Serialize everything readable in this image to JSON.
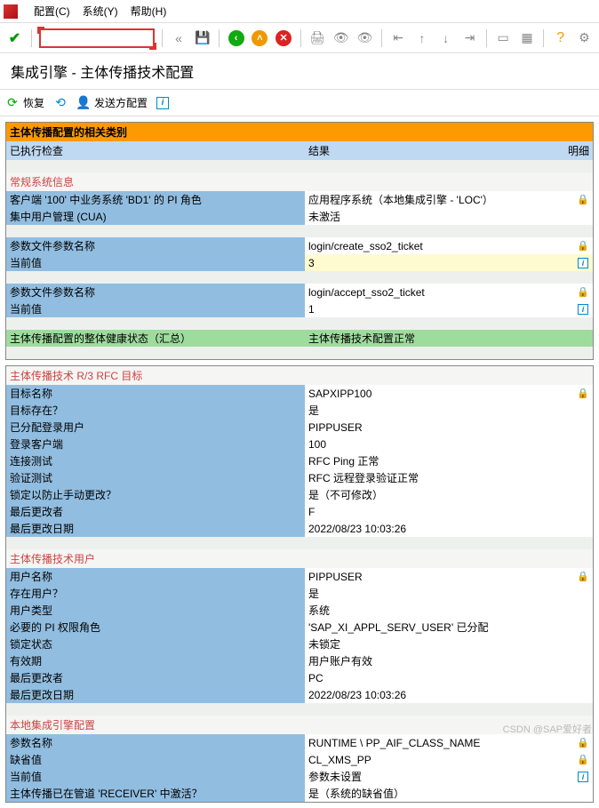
{
  "menu": {
    "config": "配置(C)",
    "system": "系统(Y)",
    "help": "帮助(H)"
  },
  "title": "集成引擎 - 主体传播技术配置",
  "subtoolbar": {
    "restore": "恢复",
    "sender_config": "发送方配置"
  },
  "panel1": {
    "header": "主体传播配置的相关类别",
    "col1": "已执行检查",
    "col2": "结果",
    "col3": "明细",
    "sec_general": "常规系统信息",
    "rows_general": [
      {
        "l": "客户端 '100' 中业务系统 'BD1' 的 PI 角色",
        "r": "应用程序系统（本地集成引擎 - 'LOC'）",
        "ic": "lock"
      },
      {
        "l": "集中用户管理 (CUA)",
        "r": "未激活",
        "ic": ""
      }
    ],
    "rows_param1": [
      {
        "l": "参数文件参数名称",
        "r": "login/create_sso2_ticket",
        "ic": "lock",
        "rbg": "white"
      },
      {
        "l": "当前值",
        "r": "3",
        "ic": "info",
        "rbg": "yellow"
      }
    ],
    "rows_param2": [
      {
        "l": "参数文件参数名称",
        "r": "login/accept_sso2_ticket",
        "ic": "lock",
        "rbg": "white"
      },
      {
        "l": "当前值",
        "r": "1",
        "ic": "info",
        "rbg": "white"
      }
    ],
    "summary": {
      "l": "主体传播配置的整体健康状态（汇总）",
      "r": "主体传播技术配置正常"
    }
  },
  "panel2": {
    "sec_rfc": "主体传播技术 R/3 RFC 目标",
    "rows_rfc": [
      {
        "l": "目标名称",
        "r": "SAPXIPP100",
        "ic": "lock"
      },
      {
        "l": "目标存在？",
        "r": "是",
        "ic": ""
      },
      {
        "l": "已分配登录用户",
        "r": "PIPPUSER",
        "ic": ""
      },
      {
        "l": "登录客户端",
        "r": "100",
        "ic": ""
      },
      {
        "l": "连接测试",
        "r": "RFC Ping 正常",
        "ic": ""
      },
      {
        "l": "验证测试",
        "r": "RFC 远程登录验证正常",
        "ic": ""
      },
      {
        "l": "锁定以防止手动更改？",
        "r": "是（不可修改）",
        "ic": ""
      },
      {
        "l": "最后更改者",
        "r": "F",
        "ic": ""
      },
      {
        "l": "最后更改日期",
        "r": "2022/08/23 10:03:26",
        "ic": ""
      }
    ],
    "sec_user": "主体传播技术用户",
    "rows_user": [
      {
        "l": "用户名称",
        "r": "PIPPUSER",
        "ic": "lock"
      },
      {
        "l": "存在用户？",
        "r": "是",
        "ic": ""
      },
      {
        "l": "用户类型",
        "r": "系统",
        "ic": ""
      },
      {
        "l": "必要的 PI 权限角色",
        "r": "'SAP_XI_APPL_SERV_USER' 已分配",
        "ic": ""
      },
      {
        "l": "锁定状态",
        "r": "未锁定",
        "ic": ""
      },
      {
        "l": "有效期",
        "r": "用户账户有效",
        "ic": ""
      },
      {
        "l": "最后更改者",
        "r": "PC",
        "ic": ""
      },
      {
        "l": "最后更改日期",
        "r": "2022/08/23 10:03:26",
        "ic": ""
      }
    ],
    "sec_local": "本地集成引擎配置",
    "rows_local": [
      {
        "l": "参数名称",
        "r": "RUNTIME \\ PP_AIF_CLASS_NAME",
        "ic": "lock"
      },
      {
        "l": "缺省值",
        "r": "CL_XMS_PP",
        "ic": "lock"
      },
      {
        "l": "当前值",
        "r": "参数未设置",
        "ic": "info"
      },
      {
        "l": "主体传播已在管道 'RECEIVER' 中激活？",
        "r": "是（系统的缺省值）",
        "ic": ""
      }
    ]
  },
  "watermark": "CSDN @SAP爱好者"
}
